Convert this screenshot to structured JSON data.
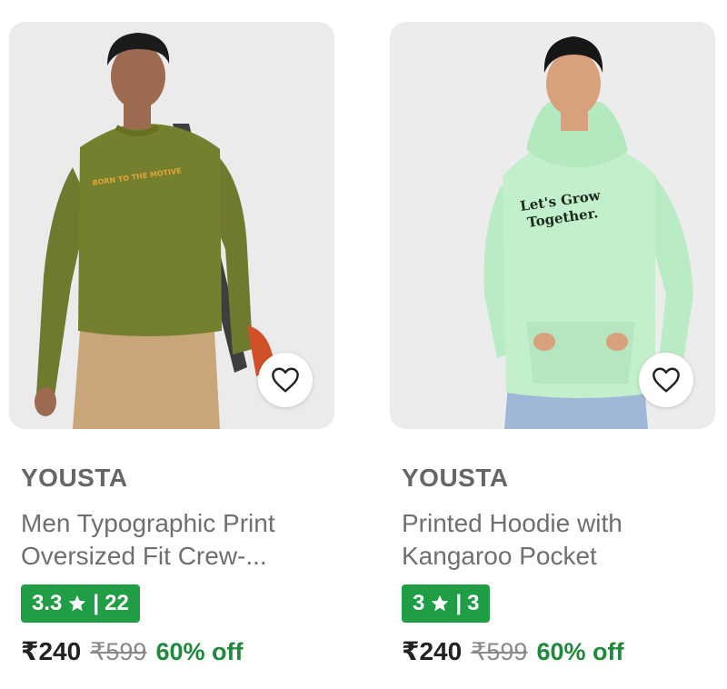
{
  "colors": {
    "rating_badge": "#1f9e45",
    "discount_text": "#1f8a3c",
    "brand_text": "#666666"
  },
  "products": [
    {
      "brand": "YOUSTA",
      "title_line1": "Men Typographic Print",
      "title_line2": "Oversized Fit Crew-...",
      "rating": "3.3",
      "rating_count": "22",
      "rating_separator": "|",
      "price": "₹240",
      "mrp": "₹599",
      "discount": "60% off",
      "image_icon": "olive-sweatshirt-model-photo",
      "shirt_print": "BORN TO THE MOTIVE",
      "wishlist_icon": "heart-outline-icon"
    },
    {
      "brand": "YOUSTA",
      "title_line1": "Printed Hoodie with",
      "title_line2": "Kangaroo Pocket",
      "rating": "3",
      "rating_count": "3",
      "rating_separator": "|",
      "price": "₹240",
      "mrp": "₹599",
      "discount": "60% off",
      "image_icon": "mint-hoodie-model-photo",
      "shirt_print_line1": "Let's Grow",
      "shirt_print_line2": "Together.",
      "wishlist_icon": "heart-outline-icon"
    }
  ]
}
